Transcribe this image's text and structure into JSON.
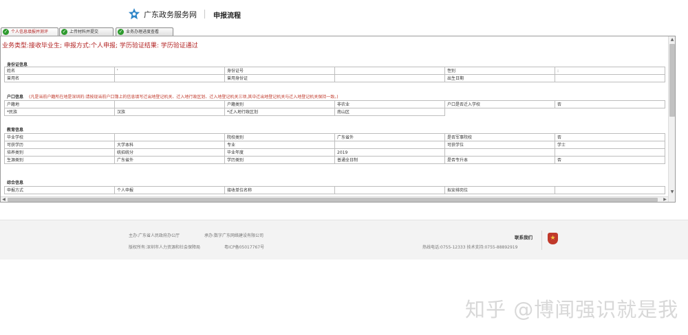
{
  "header": {
    "site_name": "广东政务服务网",
    "page_heading": "申报流程"
  },
  "tabs": [
    {
      "label": "个人信息填报并测评"
    },
    {
      "label": "上传材料并提交"
    },
    {
      "label": "业务办理进度查看"
    }
  ],
  "biz_summary": "业务类型:接收毕业生; 申报方式:个人申报; 学历验证结果: 学历验证通过",
  "identity": {
    "title": "身份证信息",
    "rows": [
      [
        "姓名",
        "'",
        "身份证号",
        "",
        "性别",
        ":"
      ],
      [
        "曾用名",
        "",
        "曾用身份证",
        "",
        "出生日期",
        ""
      ]
    ]
  },
  "household": {
    "title": "户口信息",
    "note": "(凡是当前户籍所在地是深圳的:请按现当前户口簿上的信息填写迁出地登记机关、迁入地行政区划、迁入地登记机关三项,其中迁出地登记机关与迁入地登记机关保持一致。)",
    "rows": [
      [
        "户籍地",
        "",
        "户籍类别",
        "非农业",
        "户口是否迁入学校",
        "否"
      ],
      [
        "*民族",
        "汉族",
        "*迁入地行政区划",
        "南山区"
      ]
    ]
  },
  "education": {
    "title": "教育信息",
    "rows": [
      [
        "毕业学校",
        "",
        "院校类别",
        "广东省外",
        "是否军事院校",
        "否"
      ],
      [
        "可获学历",
        "大学本科",
        "专业",
        "",
        "可获学位",
        "学士"
      ],
      [
        "培养类别",
        "统招统分",
        "毕业年度",
        "2019",
        "",
        ""
      ],
      [
        "生源类别",
        "广东省外",
        "学历类别",
        "普通全日制",
        "是否专升本",
        "否"
      ]
    ]
  },
  "general": {
    "title": "综合信息",
    "rows": [
      [
        "申报方式",
        "个人申报",
        "接收单位名称",
        "",
        "拟安排岗位",
        ""
      ]
    ]
  },
  "footer": {
    "host": "主办:广东省人民政府办公厅",
    "undertaker": "承办:数字广东网络建设有限公司",
    "copyright": "版权所有:深圳市人力资源和社会保障局",
    "icp": "粤ICP备05017767号",
    "contact_title": "联系我们",
    "contact_line": "热线电话:0755-12333 技术支持:0755-88892919"
  },
  "watermark": "知乎 @博闻强识就是我",
  "colors": {
    "alert_red": "#b22222",
    "check_green": "#2d9a2d",
    "logo_blue": "#2e86c8",
    "emblem_red": "#c0392b"
  }
}
